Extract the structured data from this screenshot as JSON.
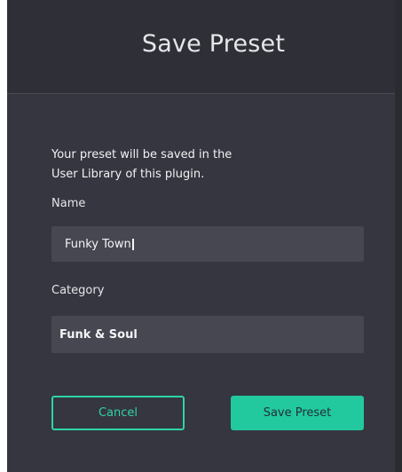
{
  "dialog": {
    "title": "Save Preset",
    "description_line1": "Your preset will be saved in the",
    "description_line2": "User Library of this plugin.",
    "name_label": "Name",
    "name_value": "Funky Town",
    "category_label": "Category",
    "category_value": "Funk & Soul",
    "cancel_label": "Cancel",
    "save_label": "Save Preset"
  },
  "colors": {
    "background": "#35363f",
    "header": "#2f3037",
    "field": "#464751",
    "accent": "#22c99e"
  }
}
